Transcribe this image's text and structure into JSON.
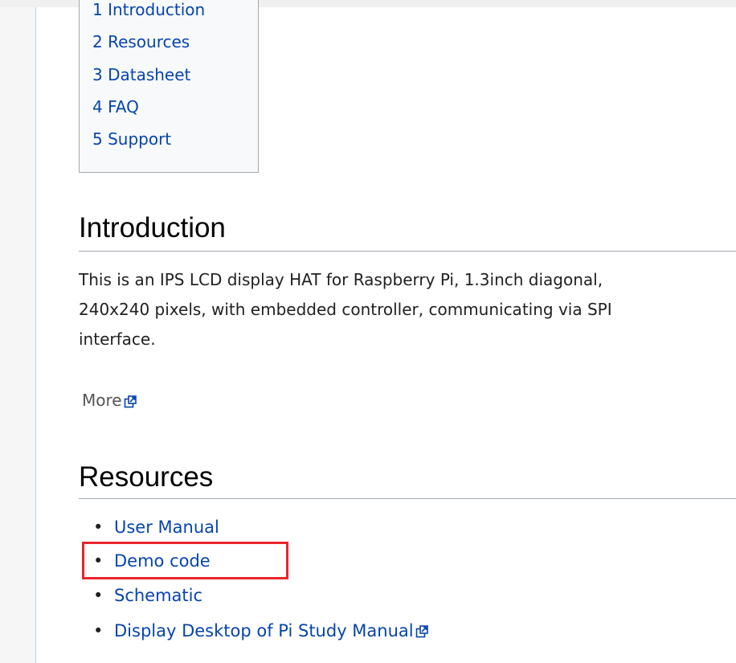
{
  "toc": {
    "items": [
      {
        "label": "1 Introduction"
      },
      {
        "label": "2 Resources"
      },
      {
        "label": "3 Datasheet"
      },
      {
        "label": "4 FAQ"
      },
      {
        "label": "5 Support"
      }
    ]
  },
  "introduction": {
    "heading": "Introduction",
    "lines": [
      "This is an IPS LCD display HAT for Raspberry Pi, 1.3inch diagonal,",
      "240x240 pixels, with embedded controller, communicating via SPI",
      "interface."
    ],
    "more_label": "More"
  },
  "resources": {
    "heading": "Resources",
    "items": [
      {
        "label": "User Manual"
      },
      {
        "label": "Demo code"
      },
      {
        "label": "Schematic"
      },
      {
        "label": "Display Desktop of Pi Study Manual"
      }
    ]
  },
  "colors": {
    "link": "#0645ad",
    "highlight": "#e8262c",
    "heading": "#000000",
    "body_text": "#202122"
  },
  "icons": {
    "external_link": "external-link-icon"
  }
}
